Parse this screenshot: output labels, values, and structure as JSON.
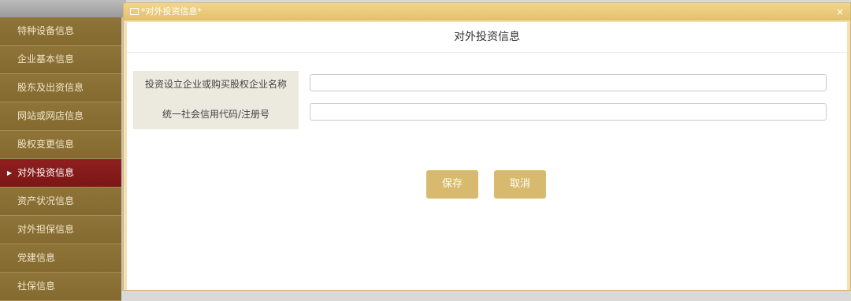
{
  "sidebar": {
    "items": [
      {
        "label": "特种设备信息"
      },
      {
        "label": "企业基本信息"
      },
      {
        "label": "股东及出资信息"
      },
      {
        "label": "网站或网店信息"
      },
      {
        "label": "股权变更信息"
      },
      {
        "label": "对外投资信息",
        "active": true
      },
      {
        "label": "资产状况信息"
      },
      {
        "label": "对外担保信息"
      },
      {
        "label": "党建信息"
      },
      {
        "label": "社保信息"
      }
    ]
  },
  "dialog": {
    "title": "*对外投资信息*",
    "close_glyph": "×",
    "heading": "对外投资信息",
    "form": {
      "company_name_label": "投资设立企业或购买股权企业名称",
      "company_name_value": "",
      "credit_code_label": "统一社会信用代码/注册号",
      "credit_code_value": ""
    },
    "buttons": {
      "save": "保存",
      "cancel": "取消"
    }
  },
  "colors": {
    "sidebar_bg": "#8a6f34",
    "sidebar_active": "#8e1f1f",
    "dialog_frame": "#f3e1b3",
    "button_bg": "#d8ba6e"
  },
  "icons": [
    "window-icon",
    "close-icon",
    "active-arrow-icon"
  ]
}
